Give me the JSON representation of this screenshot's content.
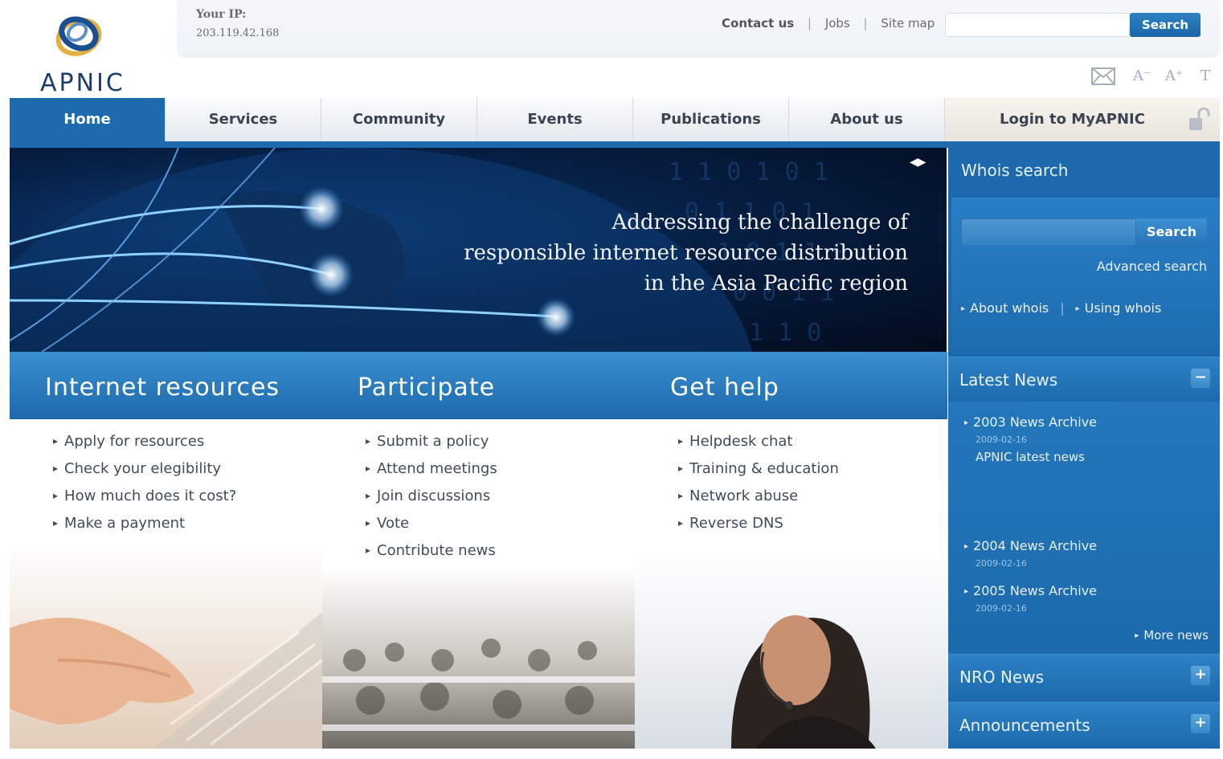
{
  "logo": {
    "text": "APNIC"
  },
  "header": {
    "ip_label": "Your IP:",
    "ip_value": "203.119.42.168",
    "links": {
      "contact": "Contact us",
      "jobs": "Jobs",
      "sitemap": "Site map",
      "separator": "|"
    },
    "search_button": "Search",
    "tools": {
      "mail_icon": "envelope-icon",
      "decrease": "A⁻",
      "increase": "A⁺",
      "text": "T"
    }
  },
  "nav": {
    "items": [
      {
        "label": "Home"
      },
      {
        "label": "Services"
      },
      {
        "label": "Community"
      },
      {
        "label": "Events"
      },
      {
        "label": "Publications"
      },
      {
        "label": "About us"
      }
    ],
    "login": "Login to MyAPNIC"
  },
  "banner": {
    "line1": "Addressing the challenge of",
    "line2": "responsible internet resource distribution",
    "line3": "in the Asia Pacific region",
    "arrows": "◀▶"
  },
  "columns": [
    {
      "title": "Internet resources",
      "links": [
        "Apply for resources",
        "Check your elegibility",
        "How much does it cost?",
        "Make a payment"
      ]
    },
    {
      "title": "Participate",
      "links": [
        "Submit a policy",
        "Attend meetings",
        "Join discussions",
        "Vote",
        "Contribute news"
      ]
    },
    {
      "title": "Get help",
      "links": [
        "Helpdesk chat",
        "Training & education",
        "Network abuse",
        "Reverse DNS"
      ]
    }
  ],
  "sidebar": {
    "whois": {
      "title": "Whois search",
      "button": "Search",
      "advanced": "Advanced search",
      "about": "About whois",
      "using": "Using whois",
      "separator": "|"
    },
    "latest_news": {
      "title": "Latest News",
      "toggle": "−",
      "items": [
        {
          "title": "2003 News Archive",
          "date": "2009-02-16",
          "summary": "APNIC latest news"
        },
        {
          "title": "2004 News Archive",
          "date": "2009-02-16"
        },
        {
          "title": "2005 News Archive",
          "date": "2009-02-16"
        }
      ],
      "more": "More news"
    },
    "nro_news": {
      "title": "NRO News",
      "toggle": "+"
    },
    "announcements": {
      "title": "Announcements",
      "toggle": "+"
    }
  },
  "colors": {
    "primary_blue": "#1d6aad",
    "header_blue": "#3a8fd0",
    "banner_dark": "#061f44"
  }
}
